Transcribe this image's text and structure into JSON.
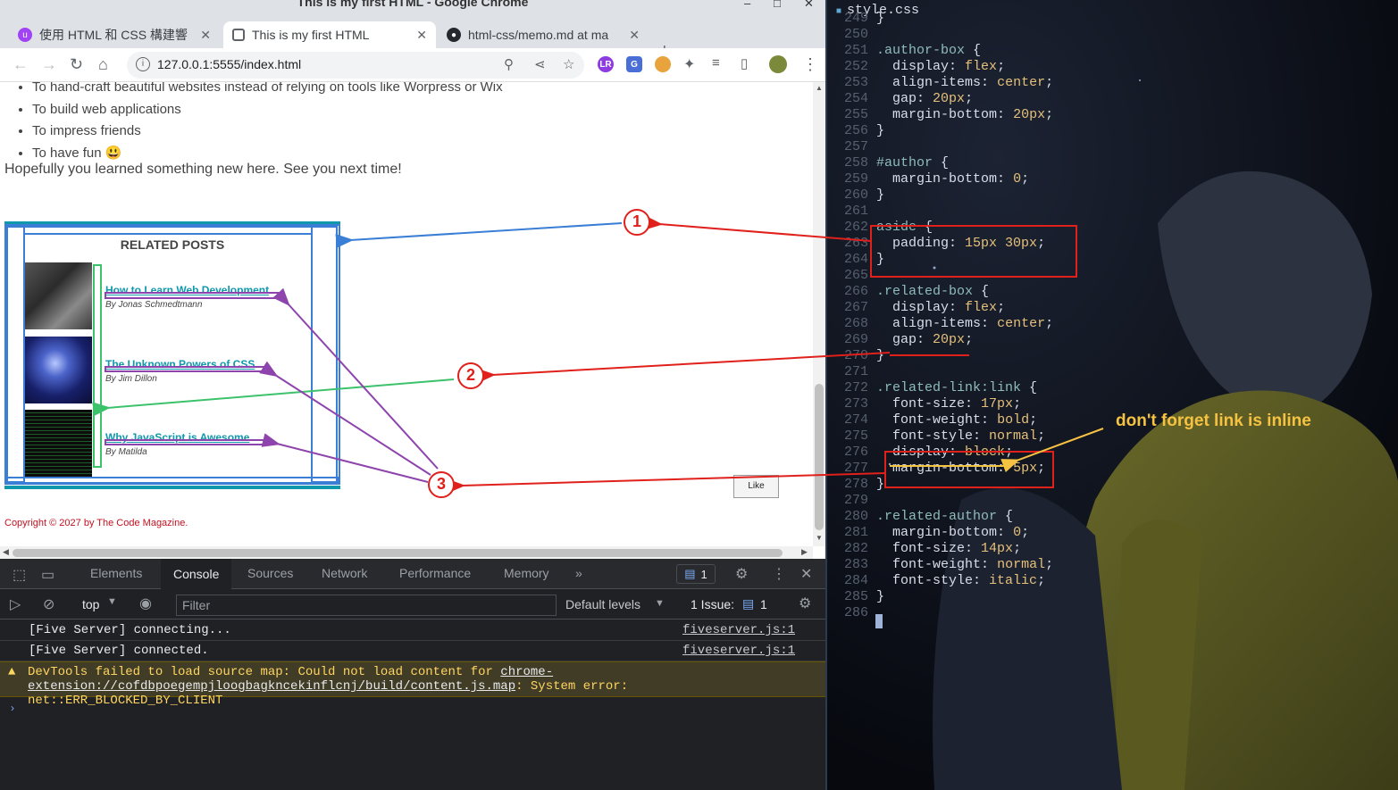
{
  "window": {
    "title": "This is my first HTML - Google Chrome",
    "tabs": [
      {
        "label": "使用 HTML 和 CSS 構建響",
        "favicon_color": "#a142f4",
        "favicon_glyph": "u"
      },
      {
        "label": "This is my first HTML",
        "favicon_color": "#5f6368",
        "favicon_glyph": "((·))"
      },
      {
        "label": "html-css/memo.md at ma",
        "favicon_color": "#24292f",
        "favicon_glyph": "github"
      }
    ],
    "new_tab_icon": "+",
    "tab_search_icon": "chevron-down",
    "controls": {
      "minimize": "–",
      "maximize": "□",
      "close": "✕"
    }
  },
  "toolbar": {
    "url": "127.0.0.1:5555/index.html",
    "extensions": [
      {
        "label": "LR",
        "color": "#8e3ce0"
      },
      {
        "label": "G",
        "color": "#4a6ed8"
      },
      {
        "label": "🍪",
        "color": "#e8a33c"
      }
    ]
  },
  "page": {
    "list_items": [
      "To hand-craft beautiful websites instead of relying on tools like Worpress or Wix",
      "To build web applications",
      "To impress friends",
      "To have fun 😃"
    ],
    "closing": "Hopefully you learned something new here. See you next time!",
    "aside_title": "RELATED POSTS",
    "related": [
      {
        "title": "How to Learn Web Development",
        "author": "By Jonas Schmedtmann"
      },
      {
        "title": "The Unknown Powers of CSS",
        "author": "By Jim Dillon"
      },
      {
        "title": "Why JavaScript is Awesome",
        "author": "By Matilda"
      }
    ],
    "like_button": "Like",
    "copyright": "Copyright © 2027 by The Code Magazine."
  },
  "devtools": {
    "tabs": [
      "Elements",
      "Console",
      "Sources",
      "Network",
      "Performance",
      "Memory"
    ],
    "active_tab": "Console",
    "more_tabs": "»",
    "message_badge": "1",
    "context": "top",
    "filter_placeholder": "Filter",
    "levels": "Default levels",
    "issues_label": "1 Issue:",
    "issues_count": "1",
    "logs": [
      {
        "message": "[Five Server] connecting...",
        "source": "fiveserver.js:1"
      },
      {
        "message": "[Five Server] connected.",
        "source": "fiveserver.js:1"
      }
    ],
    "warning": {
      "prefix": "DevTools failed to load source map: Could not load content for ",
      "link": "chrome-extension://cofdbpoegempjloogbagkncekinflcnj/build/content.js.map",
      "suffix": ": System error: net::ERR_BLOCKED_BY_CLIENT"
    },
    "prompt": "›"
  },
  "editor": {
    "filename": "style.css",
    "lines": [
      {
        "n": "249",
        "t": "}"
      },
      {
        "n": "250",
        "t": ""
      },
      {
        "n": "251",
        "t": ".author-box {"
      },
      {
        "n": "252",
        "t": "  display: flex;"
      },
      {
        "n": "253",
        "t": "  align-items: center;"
      },
      {
        "n": "254",
        "t": "  gap: 20px;"
      },
      {
        "n": "255",
        "t": "  margin-bottom: 20px;"
      },
      {
        "n": "256",
        "t": "}"
      },
      {
        "n": "257",
        "t": ""
      },
      {
        "n": "258",
        "t": "#author {"
      },
      {
        "n": "259",
        "t": "  margin-bottom: 0;"
      },
      {
        "n": "260",
        "t": "}"
      },
      {
        "n": "261",
        "t": ""
      },
      {
        "n": "262",
        "t": "aside {"
      },
      {
        "n": "263",
        "t": "  padding: 15px 30px;"
      },
      {
        "n": "264",
        "t": "}"
      },
      {
        "n": "265",
        "t": ""
      },
      {
        "n": "266",
        "t": ".related-box {"
      },
      {
        "n": "267",
        "t": "  display: flex;"
      },
      {
        "n": "268",
        "t": "  align-items: center;"
      },
      {
        "n": "269",
        "t": "  gap: 20px;"
      },
      {
        "n": "270",
        "t": "}"
      },
      {
        "n": "271",
        "t": ""
      },
      {
        "n": "272",
        "t": ".related-link:link {"
      },
      {
        "n": "273",
        "t": "  font-size: 17px;"
      },
      {
        "n": "274",
        "t": "  font-weight: bold;"
      },
      {
        "n": "275",
        "t": "  font-style: normal;"
      },
      {
        "n": "276",
        "t": "  display: block;"
      },
      {
        "n": "277",
        "t": "  margin-bottom: 5px;"
      },
      {
        "n": "278",
        "t": "}"
      },
      {
        "n": "279",
        "t": ""
      },
      {
        "n": "280",
        "t": ".related-author {"
      },
      {
        "n": "281",
        "t": "  margin-bottom: 0;"
      },
      {
        "n": "282",
        "t": "  font-size: 14px;"
      },
      {
        "n": "283",
        "t": "  font-weight: normal;"
      },
      {
        "n": "284",
        "t": "  font-style: italic;"
      },
      {
        "n": "285",
        "t": "}"
      },
      {
        "n": "286",
        "t": ""
      }
    ]
  },
  "annotations": {
    "markers": [
      "1",
      "2",
      "3"
    ],
    "note": "don't forget link is inline",
    "colors": {
      "red": "#e0201b",
      "blue": "#3a7fd5",
      "green": "#3cc26b",
      "purple": "#8e44ad",
      "yellow": "#f5c242"
    }
  }
}
